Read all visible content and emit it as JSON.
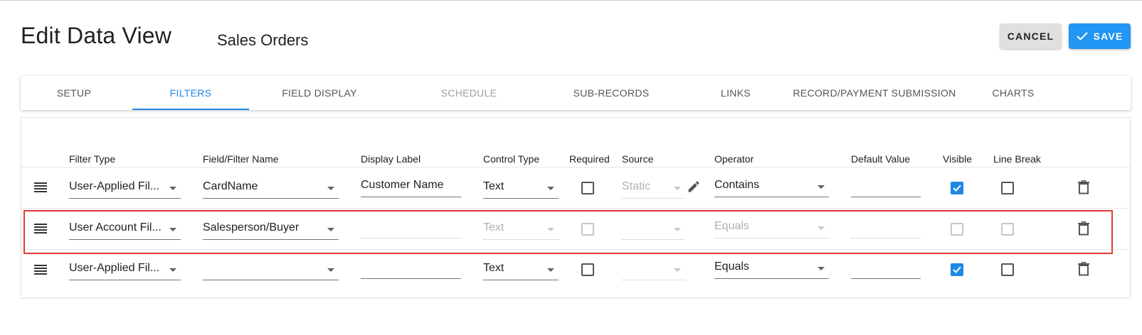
{
  "header": {
    "title": "Edit Data View",
    "view_name": "Sales Orders",
    "cancel_label": "CANCEL",
    "save_label": "SAVE"
  },
  "tabs": [
    {
      "label": "SETUP",
      "state": "normal"
    },
    {
      "label": "FILTERS",
      "state": "active"
    },
    {
      "label": "FIELD DISPLAY",
      "state": "normal"
    },
    {
      "label": "SCHEDULE",
      "state": "disabled"
    },
    {
      "label": "SUB-RECORDS",
      "state": "normal"
    },
    {
      "label": "LINKS",
      "state": "normal"
    },
    {
      "label": "RECORD/PAYMENT SUBMISSION",
      "state": "normal"
    },
    {
      "label": "CHARTS",
      "state": "normal"
    }
  ],
  "columns": {
    "filter_type": "Filter Type",
    "field_name": "Field/Filter Name",
    "display_label": "Display Label",
    "control_type": "Control Type",
    "required": "Required",
    "source": "Source",
    "operator": "Operator",
    "default_value": "Default Value",
    "visible": "Visible",
    "line_break": "Line Break"
  },
  "rows": [
    {
      "filter_type": "User-Applied Fil...",
      "field_name": "CardName",
      "display_label": "Customer Name",
      "control_type": "Text",
      "required": false,
      "source": "Static",
      "operator": "Contains",
      "default_value": "",
      "visible": true,
      "line_break": false,
      "enabled": true
    },
    {
      "filter_type": "User Account Fil...",
      "field_name": "Salesperson/Buyer",
      "display_label": "",
      "control_type": "Text",
      "required": false,
      "source": "",
      "operator": "Equals",
      "default_value": "",
      "visible": false,
      "line_break": false,
      "enabled": false
    },
    {
      "filter_type": "User-Applied Fil...",
      "field_name": "",
      "display_label": "",
      "control_type": "Text",
      "required": false,
      "source": "",
      "operator": "Equals",
      "default_value": "",
      "visible": true,
      "line_break": false,
      "enabled": true
    }
  ],
  "colors": {
    "accent": "#1e88e5",
    "save_button": "#2196f3",
    "highlight_border": "#e53935"
  },
  "icons": {
    "drag": "drag-handle-icon",
    "delete": "trash-icon",
    "edit": "pencil-icon",
    "save": "check-icon"
  }
}
